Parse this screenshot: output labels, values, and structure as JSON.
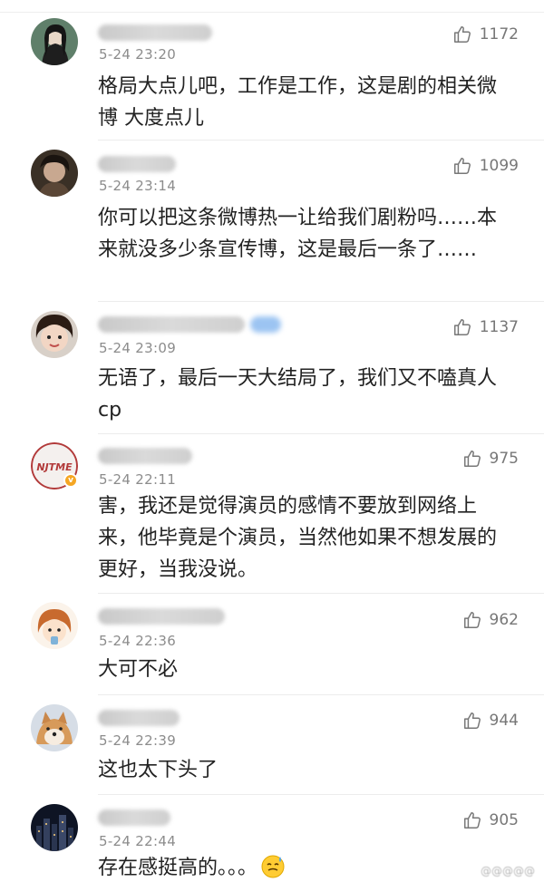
{
  "comments": [
    {
      "time": "5-24 23:20",
      "likes": "1172",
      "text": "格局大点儿吧，工作是工作，这是剧的相关微博 大度点儿",
      "avatar": "avatar-dark-hair-icon"
    },
    {
      "time": "5-24 23:14",
      "likes": "1099",
      "text": "你可以把这条微博热一让给我们剧粉吗……本来就没多少条宣传博，这是最后一条了……",
      "avatar": "avatar-portrait-icon"
    },
    {
      "time": "5-24 23:09",
      "likes": "1137",
      "text": "无语了，最后一天大结局了，我们又不嗑真人cp",
      "avatar": "avatar-child-icon"
    },
    {
      "time": "5-24 22:11",
      "likes": "975",
      "text": "害，我还是觉得演员的感情不要放到网络上来，他毕竟是个演员，当然他如果不想发展的更好，当我没说。",
      "avatar": "avatar-njtme-logo-icon",
      "avatar_text": "NJTME"
    },
    {
      "time": "5-24 22:36",
      "likes": "962",
      "text": "大可不必",
      "avatar": "avatar-cartoon-girl-icon"
    },
    {
      "time": "5-24 22:39",
      "likes": "944",
      "text": "这也太下头了",
      "avatar": "avatar-shiba-dog-icon"
    },
    {
      "time": "5-24 22:44",
      "likes": "905",
      "text": "存在感挺高的。。。",
      "avatar": "avatar-city-night-icon",
      "trailing_emoji": "sweat-smile-emoji-icon"
    }
  ],
  "icons": {
    "like": "thumbs-up-icon",
    "verified": "verified-badge-icon"
  },
  "colors": {
    "time": "#8c8c8c",
    "text": "#222222",
    "like_count": "#777777",
    "divider": "#ececec",
    "badge": "#f5a623"
  }
}
